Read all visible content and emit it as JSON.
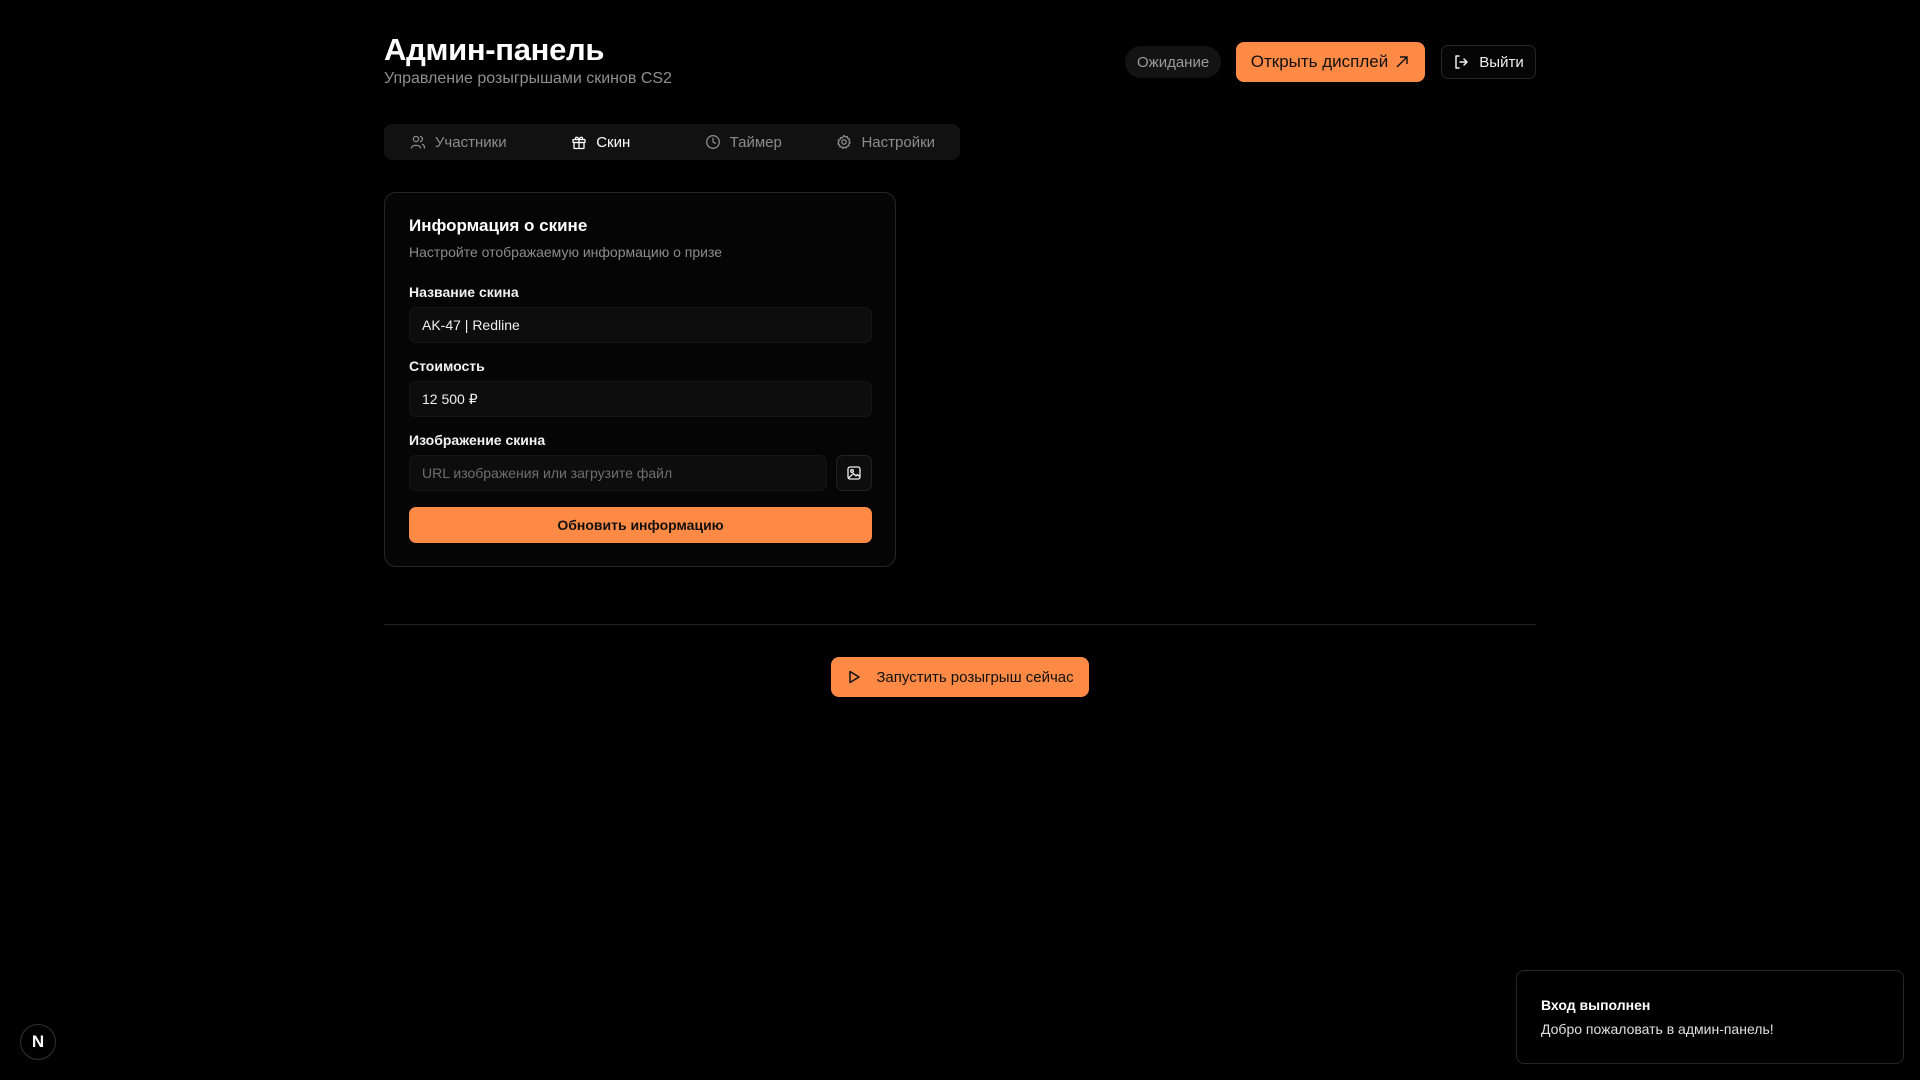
{
  "header": {
    "title": "Админ-панель",
    "subtitle": "Управление розыгрышами скинов CS2",
    "status": "Ожидание",
    "open_display_label": "Открыть дисплей",
    "logout_label": "Выйти"
  },
  "tabs": [
    {
      "label": "Участники",
      "icon": "users-icon",
      "active": false
    },
    {
      "label": "Скин",
      "icon": "gift-icon",
      "active": true
    },
    {
      "label": "Таймер",
      "icon": "clock-icon",
      "active": false
    },
    {
      "label": "Настройки",
      "icon": "gear-icon",
      "active": false
    }
  ],
  "skin_card": {
    "title": "Информация о скине",
    "description": "Настройте отображаемую информацию о призе",
    "name_label": "Название скина",
    "name_value": "AK-47 | Redline",
    "price_label": "Стоимость",
    "price_value": "12 500 ₽",
    "image_label": "Изображение скина",
    "image_placeholder": "URL изображения или загрузите файл",
    "update_label": "Обновить информацию"
  },
  "start_button_label": "Запустить розыгрыш сейчас",
  "toast": {
    "title": "Вход выполнен",
    "text": "Добро пожаловать в админ-панель!"
  },
  "badge_letter": "N",
  "colors": {
    "background": "#000000",
    "accent": "#ff8a45",
    "border": "#262626",
    "muted_text": "#8c8c8c"
  }
}
